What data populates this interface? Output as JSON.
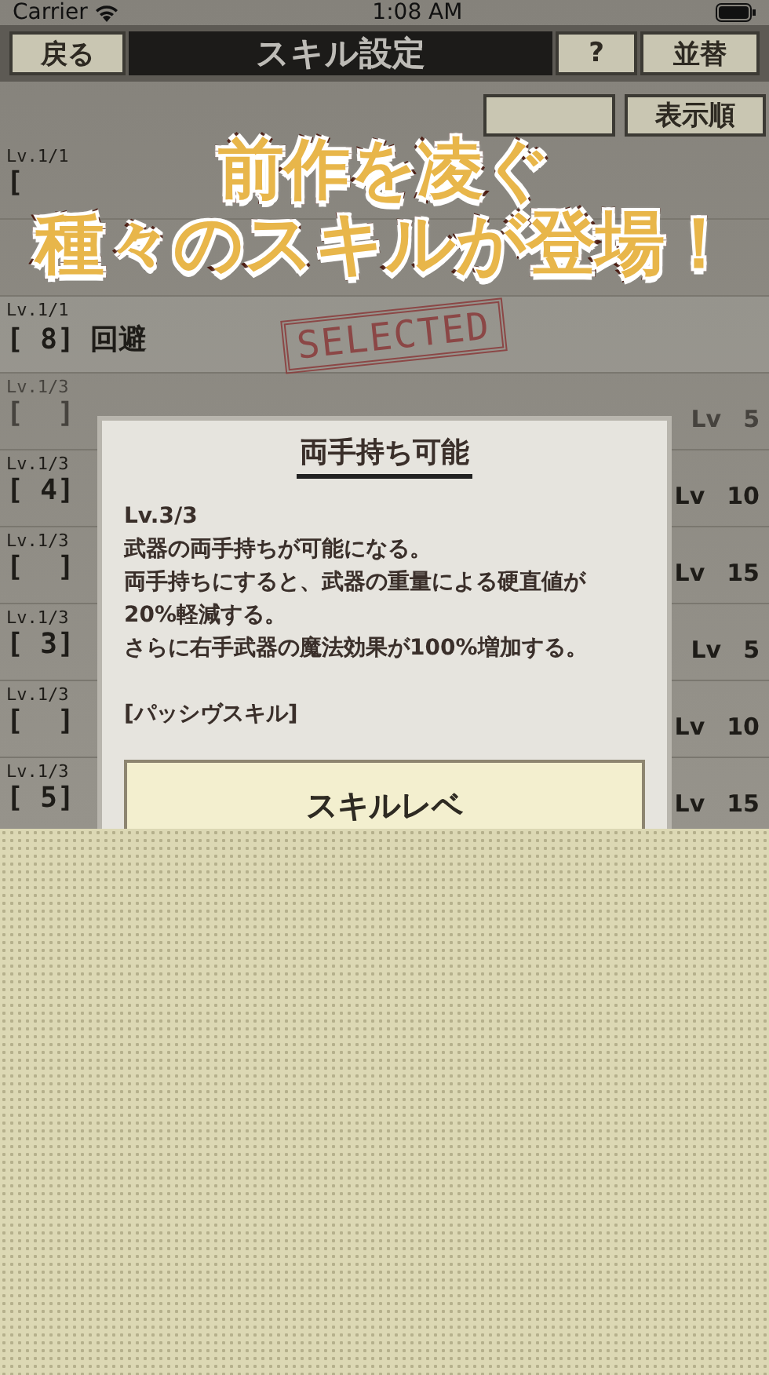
{
  "status_bar": {
    "carrier": "Carrier",
    "time": "1:08 AM"
  },
  "header": {
    "back": "戻る",
    "title": "スキル設定",
    "help": "?",
    "sort": "並替"
  },
  "toolbar": {
    "order": "表示順"
  },
  "headline": [
    "前作を凌ぐ",
    "種々のスキルが登場！"
  ],
  "skills": [
    {
      "level": "Lv.1/1",
      "slot": "[",
      "selected": false
    },
    {
      "selected": false
    },
    {
      "level": "Lv.1/1",
      "slot": "[ 8]",
      "name": "回避",
      "selected": true
    },
    {
      "level": "Lv.1/3",
      "slot": "[  ]",
      "req": "Lv",
      "req_lv": "5",
      "selected": false,
      "disabled": true
    },
    {
      "level": "Lv.1/3",
      "slot": "[ 4]",
      "req": "Lv",
      "req_lv": "10",
      "selected": false
    },
    {
      "level": "Lv.1/3",
      "slot": "[  ]",
      "req": "Lv",
      "req_lv": "15",
      "selected": false
    },
    {
      "level": "Lv.1/3",
      "slot": "[ 3]",
      "req": "Lv",
      "req_lv": "5",
      "selected": false
    },
    {
      "level": "Lv.1/3",
      "slot": "[  ]",
      "req": "Lv",
      "req_lv": "10",
      "selected": false
    },
    {
      "level": "Lv.1/3",
      "slot": "[ 5]",
      "req": "Lv",
      "req_lv": "15",
      "selected": false
    }
  ],
  "stamp": "SELECTED",
  "dialog": {
    "title": "両手持ち可能",
    "level": "Lv.3/3",
    "lines": [
      "武器の両手持ちが可能になる。",
      "両手持ちにすると、武器の重量による硬直値が",
      "20%軽減する。",
      "さらに右手武器の魔法効果が100%増加する。"
    ],
    "type": "[パッシヴスキル]",
    "button": "スキルレベ"
  }
}
